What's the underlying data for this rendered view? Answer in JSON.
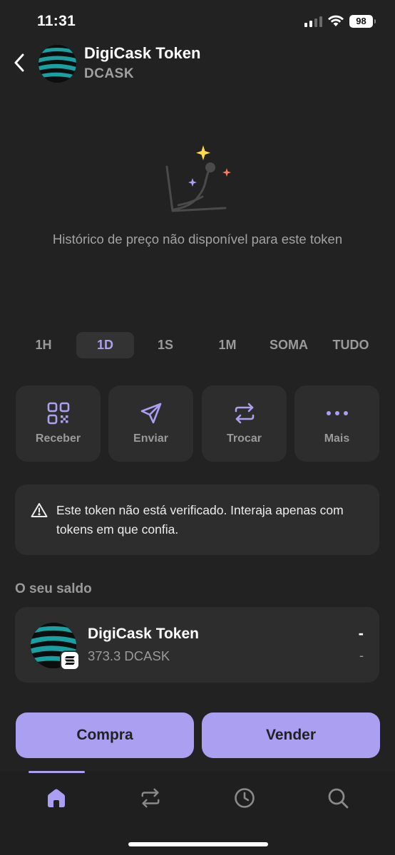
{
  "status_bar": {
    "time": "11:31",
    "battery": "98"
  },
  "header": {
    "token_name": "DigiCask Token",
    "token_symbol": "DCASK"
  },
  "chart_empty": {
    "message": "Histórico de preço não disponível para este token"
  },
  "time_ranges": [
    {
      "label": "1H",
      "active": false
    },
    {
      "label": "1D",
      "active": true
    },
    {
      "label": "1S",
      "active": false
    },
    {
      "label": "1M",
      "active": false
    },
    {
      "label": "SOMA",
      "active": false
    },
    {
      "label": "TUDO",
      "active": false
    }
  ],
  "actions": [
    {
      "label": "Receber",
      "icon": "qr-code-icon"
    },
    {
      "label": "Enviar",
      "icon": "send-icon"
    },
    {
      "label": "Trocar",
      "icon": "swap-icon"
    },
    {
      "label": "Mais",
      "icon": "more-icon"
    }
  ],
  "warning": {
    "text": "Este token não está verificado. Interaja apenas com tokens em que confia.",
    "icon": "warning-icon"
  },
  "balance": {
    "title": "O seu saldo",
    "token_name": "DigiCask Token",
    "amount": "373.3 DCASK",
    "value": "-",
    "change": "-"
  },
  "cta": {
    "buy_label": "Compra",
    "sell_label": "Vender"
  },
  "tabs": [
    {
      "icon": "home-icon",
      "active": true
    },
    {
      "icon": "swap-icon",
      "active": false
    },
    {
      "icon": "history-icon",
      "active": false
    },
    {
      "icon": "search-icon",
      "active": false
    }
  ],
  "colors": {
    "accent": "#ab9ff2",
    "background": "#222222",
    "card": "#2d2d2d",
    "muted": "#9a9a9a"
  }
}
